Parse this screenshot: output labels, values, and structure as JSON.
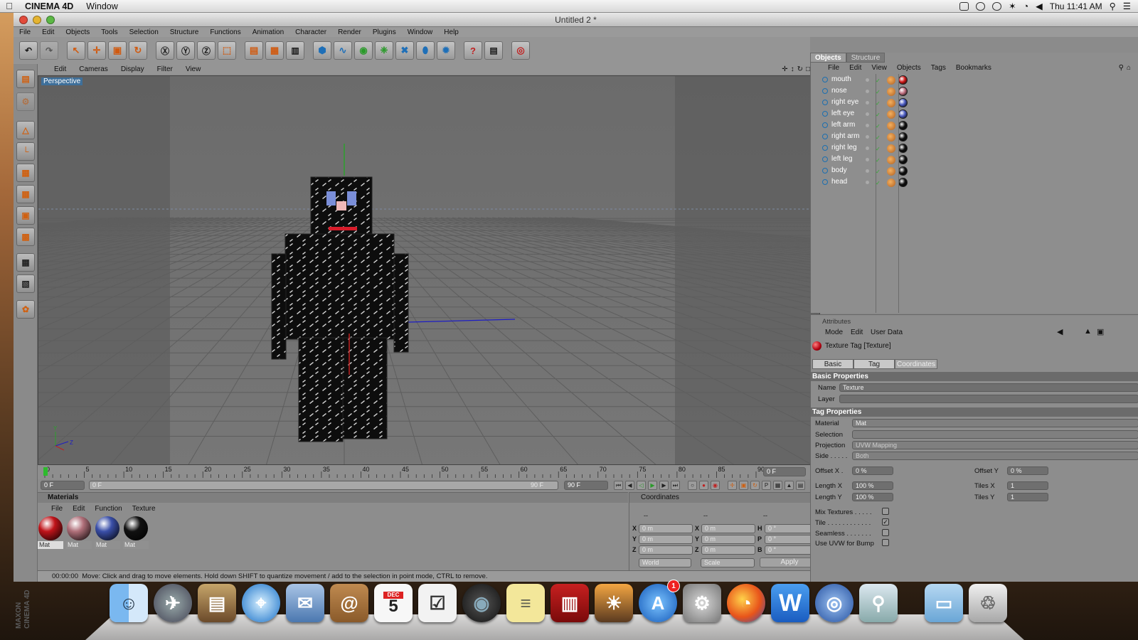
{
  "menubar": {
    "app_name": "CINEMA 4D",
    "items": [
      "Window"
    ],
    "clock": "Thu 11:41 AM"
  },
  "window": {
    "title": "Untitled 2 *",
    "menu": [
      "File",
      "Edit",
      "Objects",
      "Tools",
      "Selection",
      "Structure",
      "Functions",
      "Animation",
      "Character",
      "Render",
      "Plugins",
      "Window",
      "Help"
    ]
  },
  "toolbar": {
    "buttons": [
      "undo-icon",
      "redo-icon",
      "select-icon",
      "move-icon",
      "scale-icon",
      "rotate-icon",
      "x-axis-icon",
      "y-axis-icon",
      "z-axis-icon",
      "world-coordinates-icon",
      "render-view-icon",
      "render-picture-viewer-icon",
      "render-settings-icon",
      "cube-icon",
      "spline-icon",
      "nurbs-icon",
      "array-icon",
      "deformer-icon",
      "scene-icon",
      "light-icon",
      "camera-icon",
      "help-icon",
      "layers-icon",
      "content-browser-icon"
    ]
  },
  "viewport": {
    "menu": [
      "Edit",
      "Cameras",
      "Display",
      "Filter",
      "View"
    ],
    "label": "Perspective"
  },
  "timeline": {
    "ticks": [
      "0",
      "5",
      "10",
      "15",
      "20",
      "25",
      "30",
      "35",
      "40",
      "45",
      "50",
      "55",
      "60",
      "65",
      "70",
      "75",
      "80",
      "85",
      "90"
    ],
    "current_frame": "0 F",
    "start_field": "0 F",
    "preview_start": "0 F",
    "preview_end": "90 F",
    "end_field": "90 F"
  },
  "materials": {
    "title": "Materials",
    "menu": [
      "File",
      "Edit",
      "Function",
      "Texture"
    ],
    "items": [
      {
        "label": "Mat",
        "color": "#c0141a"
      },
      {
        "label": "Mat",
        "color": "#b0707a"
      },
      {
        "label": "Mat",
        "color": "#3a4fa8"
      },
      {
        "label": "Mat",
        "color": "#111111"
      }
    ]
  },
  "coordinates": {
    "title": "Coordinates",
    "headers": [
      "--",
      "--",
      "--"
    ],
    "rows": [
      {
        "pos_label": "X",
        "pos": "0 m",
        "size_label": "X",
        "size": "0 m",
        "rot_label": "H",
        "rot": "0 °"
      },
      {
        "pos_label": "Y",
        "pos": "0 m",
        "size_label": "Y",
        "size": "0 m",
        "rot_label": "P",
        "rot": "0 °"
      },
      {
        "pos_label": "Z",
        "pos": "0 m",
        "size_label": "Z",
        "size": "0 m",
        "rot_label": "B",
        "rot": "0 °"
      }
    ],
    "mode_select": "World",
    "scale_select": "Scale",
    "apply_label": "Apply"
  },
  "status": {
    "time": "00:00:00",
    "message": "Move: Click and drag to move elements. Hold down SHIFT to quantize movement / add to the selection in point mode, CTRL to remove."
  },
  "object_manager": {
    "tabs": [
      "Objects",
      "Structure"
    ],
    "menu": [
      "File",
      "Edit",
      "View",
      "Objects",
      "Tags",
      "Bookmarks"
    ],
    "objects": [
      {
        "name": "mouth",
        "tag_color": "#d01818"
      },
      {
        "name": "nose",
        "tag_color": "#c07080"
      },
      {
        "name": "right eye",
        "tag_color": "#4a5ac0"
      },
      {
        "name": "left eye",
        "tag_color": "#4a5ac0"
      },
      {
        "name": "left arm",
        "tag_color": "#111111"
      },
      {
        "name": "right arm",
        "tag_color": "#111111"
      },
      {
        "name": "right leg",
        "tag_color": "#111111"
      },
      {
        "name": "left leg",
        "tag_color": "#111111"
      },
      {
        "name": "body",
        "tag_color": "#111111"
      },
      {
        "name": "head",
        "tag_color": "#111111"
      }
    ]
  },
  "attributes": {
    "title": "Attributes",
    "menu": [
      "Mode",
      "Edit",
      "User Data"
    ],
    "object_title": "Texture Tag [Texture]",
    "tabs": [
      "Basic",
      "Tag",
      "Coordinates"
    ],
    "basic_header": "Basic Properties",
    "name_label": "Name",
    "name_value": "Texture",
    "layer_label": "Layer",
    "tag_header": "Tag Properties",
    "material_label": "Material",
    "material_value": "Mat",
    "selection_label": "Selection",
    "projection_label": "Projection",
    "projection_value": "UVW Mapping",
    "side_label": "Side . . . . .",
    "side_value": "Both",
    "offset_x_label": "Offset X .",
    "offset_x_value": "0 %",
    "offset_y_label": "Offset Y",
    "offset_y_value": "0 %",
    "length_x_label": "Length X",
    "length_x_value": "100 %",
    "tiles_x_label": "Tiles X",
    "tiles_x_value": "1",
    "length_y_label": "Length Y",
    "length_y_value": "100 %",
    "tiles_y_label": "Tiles Y",
    "tiles_y_value": "1",
    "mix_textures_label": "Mix Textures . . . . .",
    "mix_textures_checked": false,
    "tile_label": "Tile . . . . . . . . . . . .",
    "tile_checked": true,
    "seamless_label": "Seamless . . . . . . .",
    "seamless_checked": false,
    "uvw_bump_label": "Use UVW for Bump",
    "uvw_bump_checked": false
  },
  "dock": {
    "calendar_day": "5",
    "calendar_month": "DEC",
    "appstore_badge": "1",
    "apps": [
      "finder-icon",
      "launchpad-icon",
      "image-capture-icon",
      "safari-icon",
      "mail-icon",
      "address-book-icon",
      "calendar-icon",
      "reminders-icon",
      "facetime-icon",
      "stickies-icon",
      "photo-booth-icon",
      "iphoto-icon",
      "app-store-icon",
      "system-preferences-icon",
      "firefox-icon",
      "word-icon",
      "network-icon",
      "preview-icon",
      "folder-icon",
      "trash-icon"
    ]
  },
  "colors": {
    "accent": "#3e6f9a",
    "chrome": "#8d8d8d",
    "header": "#6b6b6b"
  }
}
